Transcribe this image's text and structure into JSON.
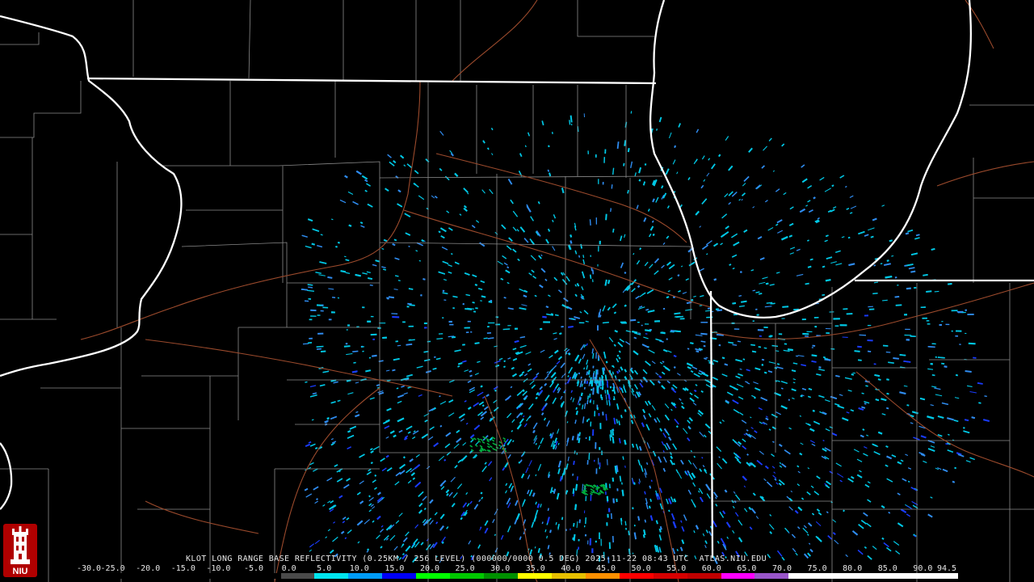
{
  "caption": "KLOT LONG RANGE BASE REFLECTIVITY (0.25KM / 256 LEVEL) (000000/0000 0.5 DEG) 2025-11-22 08:43 UTC  ATLAS.NIU.EDU",
  "logo_text": "NIU",
  "legend": {
    "labels": [
      "-30.0",
      "-25.0",
      "-20.0",
      "-15.0",
      "-10.0",
      "-5.0",
      "0.0",
      "5.0",
      "10.0",
      "15.0",
      "20.0",
      "25.0",
      "30.0",
      "35.0",
      "40.0",
      "45.0",
      "50.0",
      "55.0",
      "60.0",
      "65.0",
      "70.0",
      "75.0",
      "80.0",
      "85.0",
      "90.0",
      "94.5"
    ],
    "colors": [
      "#000000",
      "#000000",
      "#000000",
      "#000000",
      "#000000",
      "#000000",
      "#4a4a4a",
      "#00e5ee",
      "#009cf7",
      "#0000f6",
      "#00ff00",
      "#00c800",
      "#009000",
      "#ffff00",
      "#e7c000",
      "#ff9000",
      "#ff0000",
      "#d60000",
      "#c00000",
      "#ff00ff",
      "#9955c9",
      "#ffffff",
      "#ffffff",
      "#ffffff",
      "#ffffff",
      "#ffffff"
    ]
  },
  "colors": {
    "background": "#000000",
    "state_border": "#ffffff",
    "county_border": "#8a8a8a",
    "highway": "#9b4a2c",
    "echo_light": "#00c8e6",
    "echo_mid": "#2f8cf0",
    "echo_heavy": "#1a3cff",
    "echo_green": "#00b040"
  }
}
